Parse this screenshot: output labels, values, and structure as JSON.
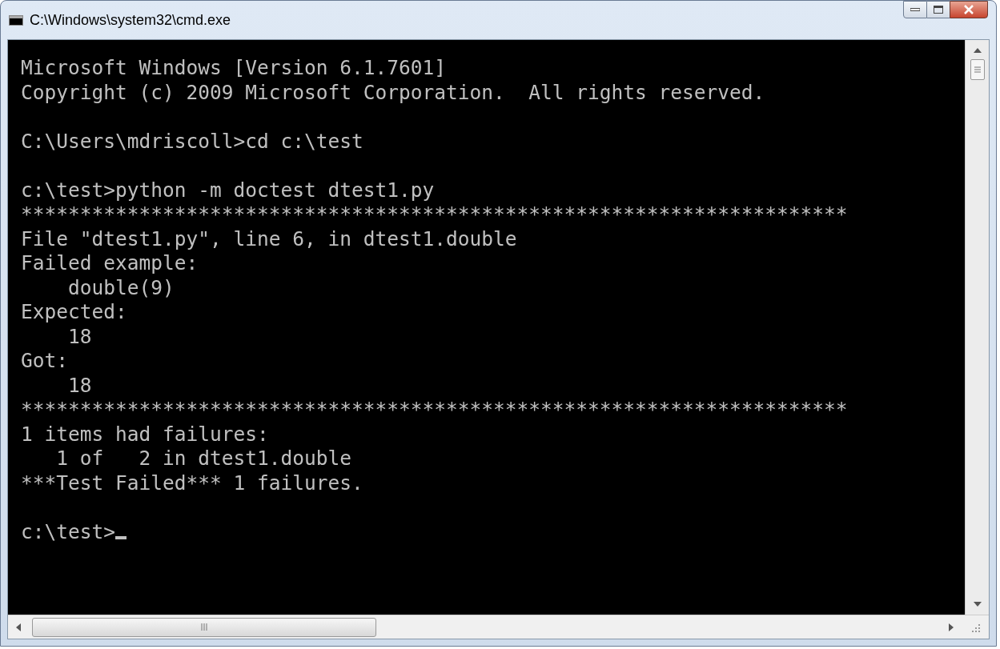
{
  "window": {
    "title": "C:\\Windows\\system32\\cmd.exe"
  },
  "console_lines": [
    {
      "kind": "text",
      "text": "Microsoft Windows [Version 6.1.7601]"
    },
    {
      "kind": "text",
      "text": "Copyright (c) 2009 Microsoft Corporation.  All rights reserved."
    },
    {
      "kind": "blank"
    },
    {
      "kind": "text",
      "text": "C:\\Users\\mdriscoll>cd c:\\test"
    },
    {
      "kind": "blank"
    },
    {
      "kind": "text",
      "text": "c:\\test>python -m doctest dtest1.py"
    },
    {
      "kind": "text",
      "text": "**********************************************************************"
    },
    {
      "kind": "text",
      "text": "File \"dtest1.py\", line 6, in dtest1.double"
    },
    {
      "kind": "text",
      "text": "Failed example:"
    },
    {
      "kind": "text",
      "text": "    double(9)"
    },
    {
      "kind": "text",
      "text": "Expected:"
    },
    {
      "kind": "text",
      "text": "    18"
    },
    {
      "kind": "text",
      "text": "Got:"
    },
    {
      "kind": "text",
      "text": "    18"
    },
    {
      "kind": "text",
      "text": "**********************************************************************"
    },
    {
      "kind": "text",
      "text": "1 items had failures:"
    },
    {
      "kind": "text",
      "text": "   1 of   2 in dtest1.double"
    },
    {
      "kind": "text",
      "text": "***Test Failed*** 1 failures."
    },
    {
      "kind": "blank"
    },
    {
      "kind": "prompt",
      "text": "c:\\test>"
    }
  ]
}
